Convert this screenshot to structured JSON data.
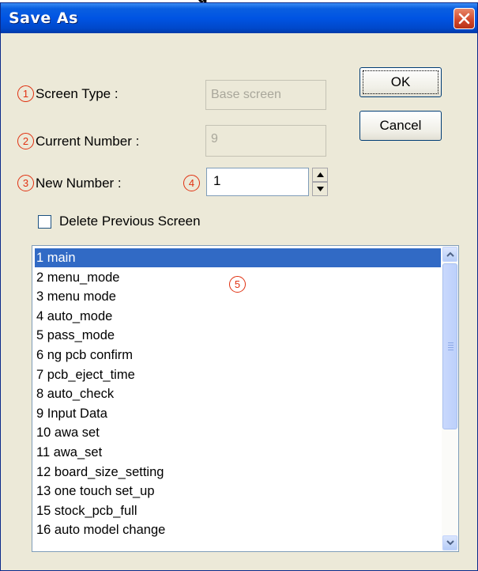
{
  "dialog": {
    "title": "Save As",
    "close_icon": "close-icon"
  },
  "form": {
    "screen_type": {
      "marker": "1",
      "label": "Screen Type :",
      "value": "Base screen"
    },
    "current_number": {
      "marker": "2",
      "label": "Current Number :",
      "value": "9"
    },
    "new_number": {
      "marker": "3",
      "label": "New Number :",
      "input_marker": "4",
      "value": "1"
    },
    "delete_previous": {
      "label": "Delete Previous Screen",
      "checked": false
    }
  },
  "buttons": {
    "ok": "OK",
    "cancel": "Cancel"
  },
  "list": {
    "marker": "5",
    "selected_index": 0,
    "items": [
      "1 main",
      "2 menu_mode",
      "3 menu mode",
      "4 auto_mode",
      "5 pass_mode",
      "6 ng pcb confirm",
      "7 pcb_eject_time",
      "8 auto_check",
      "9 Input Data",
      "10 awa set",
      "11 awa_set",
      "12 board_size_setting",
      "13 one touch set_up",
      "15 stock_pcb_full",
      "16 auto model change"
    ]
  },
  "colors": {
    "marker": "#e03010",
    "selection": "#316ac5",
    "titlebar": "#0054e3"
  }
}
